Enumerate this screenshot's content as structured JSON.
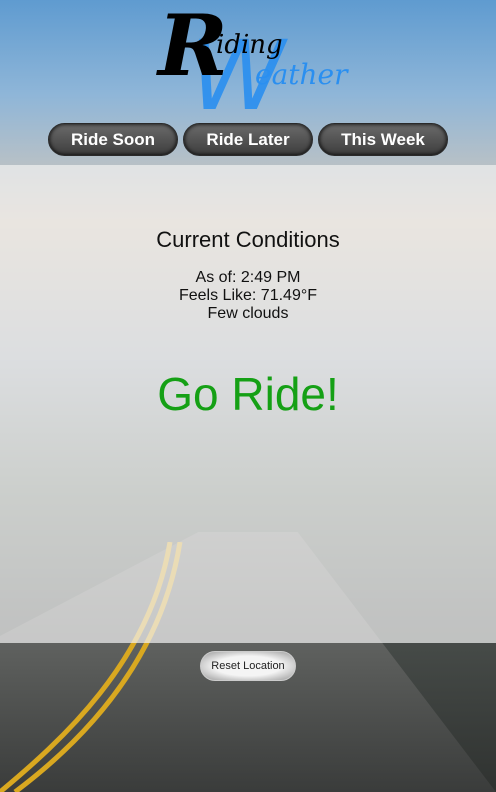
{
  "logo": {
    "line1": "Riding",
    "line2": "Weather"
  },
  "tabs": [
    {
      "label": "Ride Soon"
    },
    {
      "label": "Ride Later"
    },
    {
      "label": "This Week"
    }
  ],
  "conditions": {
    "title": "Current Conditions",
    "as_of": "As of: 2:49 PM",
    "feels_like": "Feels Like: 71.49°F",
    "description": "Few clouds",
    "verdict": "Go Ride!"
  },
  "reset_label": "Reset Location",
  "colors": {
    "verdict": "#15a015",
    "logo_blue": "#2a8ff0"
  }
}
